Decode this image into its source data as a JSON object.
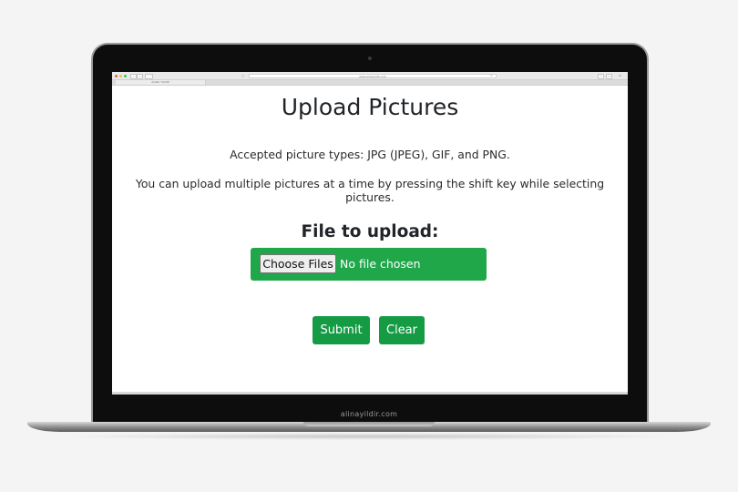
{
  "browser": {
    "url": "www.alinayildir.com",
    "tab_title": "ALINA YILDIR"
  },
  "page": {
    "title": "Upload Pictures",
    "accepted_types": "Accepted picture types: JPG (JPEG), GIF, and PNG.",
    "multi_upload_hint": "You can upload multiple pictures at a time by pressing the shift key while selecting pictures.",
    "file_heading": "File to upload:",
    "choose_files_label": "Choose Files",
    "no_file_label": "No file chosen",
    "submit_label": "Submit",
    "clear_label": "Clear"
  },
  "device": {
    "brand_caption": "alinayildir.com"
  },
  "colors": {
    "accent_green": "#1fa74a",
    "button_green": "#169b45",
    "title_text": "#212529"
  },
  "icons": {
    "back": "chevron-left-icon",
    "forward": "chevron-right-icon",
    "sidebar": "sidebar-icon",
    "share": "share-icon",
    "reload": "reload-icon",
    "settings": "gear-icon"
  }
}
